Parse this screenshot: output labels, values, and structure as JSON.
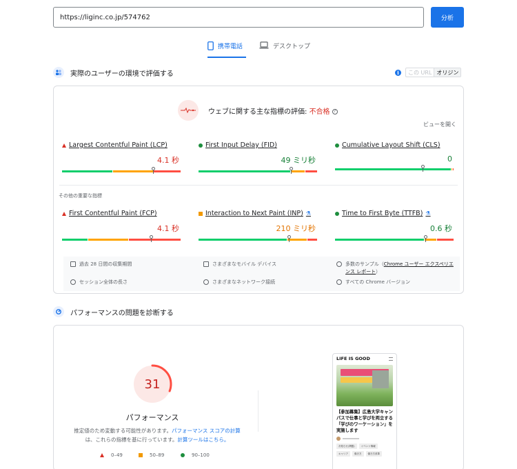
{
  "url_bar": {
    "value": "https://liginc.co.jp/574762",
    "button": "分析"
  },
  "tabs": [
    {
      "label": "携帯電話",
      "active": true
    },
    {
      "label": "デスクトップ",
      "active": false
    }
  ],
  "field": {
    "title": "実際のユーザーの環境で評価する",
    "toggle": {
      "this_url": "この URL",
      "origin": "オリジン"
    },
    "assessment": {
      "label": "ウェブに関する主な指標の評価: ",
      "status": "不合格",
      "help": "?"
    },
    "expand": "ビューを開く",
    "core_metrics": [
      {
        "name": "Largest Contentful Paint (LCP)",
        "value": "4.1 秒",
        "rating": "poor",
        "dist": [
          0.43,
          0.34,
          0.23
        ],
        "marker": 0.77
      },
      {
        "name": "First Input Delay (FID)",
        "value": "49 ミリ秒",
        "rating": "good",
        "dist": [
          0.78,
          0.12,
          0.1
        ],
        "marker": 0.78
      },
      {
        "name": "Cumulative Layout Shift (CLS)",
        "value": "0",
        "rating": "good",
        "dist": [
          0.99,
          0.005,
          0.005
        ],
        "marker": 0.74
      }
    ],
    "other_label": "その他の重要な指標",
    "other_metrics": [
      {
        "name": "First Contentful Paint (FCP)",
        "value": "4.1 秒",
        "rating": "poor",
        "dist": [
          0.22,
          0.34,
          0.44
        ],
        "marker": 0.75,
        "lab": false
      },
      {
        "name": "Interaction to Next Paint (INP)",
        "value": "210 ミリ秒",
        "rating": "ni",
        "dist": [
          0.75,
          0.17,
          0.08
        ],
        "marker": 0.76,
        "lab": true
      },
      {
        "name": "Time to First Byte (TTFB)",
        "value": "0.6 秒",
        "rating": "good",
        "dist": [
          0.76,
          0.1,
          0.14
        ],
        "marker": 0.76,
        "lab": true
      }
    ],
    "info": {
      "period": "過去 28 日間の収集期間",
      "session": "セッション全体の長さ",
      "devices": "さまざまなモバイル デバイス",
      "network": "さまざまなネットワーク接続",
      "samples_prefix": "多数のサンプル（",
      "samples_link": "Chrome ユーザー エクスペリエンス レポート",
      "samples_suffix": "）",
      "versions": "すべての Chrome バージョン"
    }
  },
  "diagnose": {
    "title": "パフォーマンスの問題を診断する",
    "score": "31",
    "score_fraction": 0.31,
    "label": "パフォーマンス",
    "note_1": "推定値のため変動する可能性があります。",
    "note_link_1": "パフォーマンス スコアの計算",
    "note_2": "は、これらの指標を基に行っています。",
    "note_link_2": "計算ツールはこちら。",
    "legend": [
      {
        "range": "0–49",
        "kind": "poor"
      },
      {
        "range": "50–89",
        "kind": "ni"
      },
      {
        "range": "90–100",
        "kind": "good"
      }
    ],
    "preview": {
      "logo": "LIFE IS GOOD",
      "headline": "【参加募集】広島大学キャンパスで仕事と学びを両立する「学びのワーケーション」を実施します",
      "tags": [
        "お知らせ(掲載)",
        "イベント情報",
        "キャリア",
        "働き方",
        "働き方改革"
      ]
    }
  },
  "colors": {
    "accent": "#1a73e8",
    "good": "#0cce6b",
    "ni": "#ffa400",
    "poor": "#ff4e42"
  }
}
